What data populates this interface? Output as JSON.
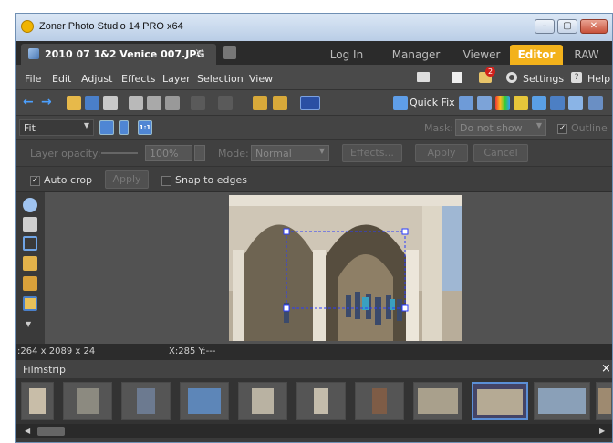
{
  "window": {
    "title": "Zoner Photo Studio 14 PRO x64",
    "btn_min": "–",
    "btn_max": "▢",
    "btn_close": "✕"
  },
  "tabs": {
    "document": "2010 07 1&2 Venice 007.JPG",
    "document_close": "×",
    "login": "Log In",
    "manager": "Manager",
    "viewer": "Viewer",
    "editor": "Editor",
    "raw": "RAW"
  },
  "menu": {
    "file": "File",
    "edit": "Edit",
    "adjust": "Adjust",
    "effects": "Effects",
    "layer": "Layer",
    "selection": "Selection",
    "view": "View",
    "badge_count": "2",
    "settings": "Settings",
    "help": "Help"
  },
  "toolbar": {
    "quick_fix": "Quick Fix"
  },
  "options": {
    "zoom_value": "Fit",
    "mask_label": "Mask:",
    "mask_value": "Do not show",
    "outline_label": "Outline",
    "zoom_11": "1:1"
  },
  "layer": {
    "opacity_label": "Layer opacity:",
    "opacity_value": "100%",
    "mode_label": "Mode:",
    "mode_value": "Normal",
    "effects_btn": "Effects...",
    "apply_btn": "Apply",
    "cancel_btn": "Cancel"
  },
  "crop": {
    "auto_crop_label": "Auto crop",
    "apply_btn": "Apply",
    "snap_label": "Snap to edges"
  },
  "status": {
    "dimensions": ":264 x 2089 x 24",
    "coords": "X:285 Y:---"
  },
  "filmstrip": {
    "title": "Filmstrip",
    "close": "×",
    "thumb_count": 11,
    "selected_index": 8
  },
  "colors": {
    "accent": "#f3b21b",
    "selection": "#5b8fd6"
  }
}
